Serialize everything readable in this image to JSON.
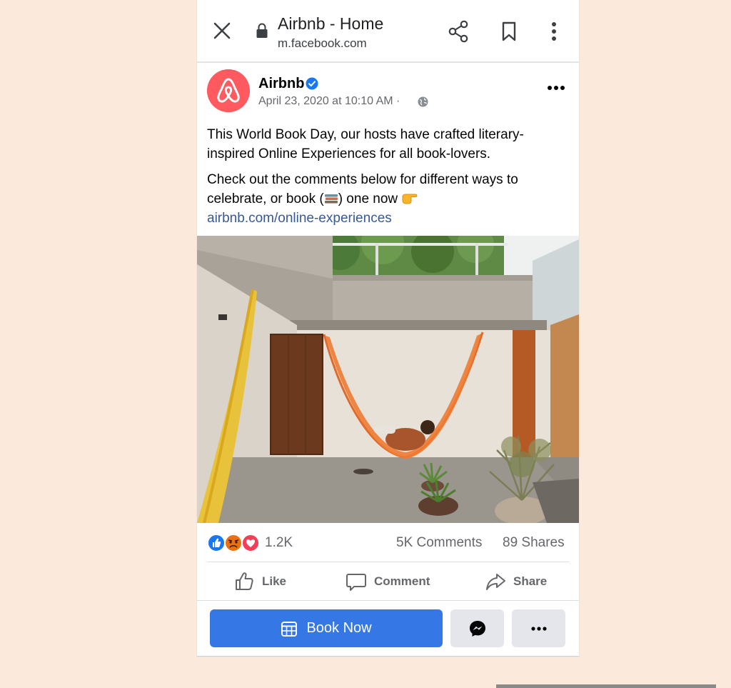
{
  "browser": {
    "title": "Airbnb - Home",
    "url": "m.facebook.com"
  },
  "post": {
    "page_name": "Airbnb",
    "timestamp": "April 23, 2020 at 10:10 AM · ",
    "text_para1": "This World Book Day, our hosts have crafted literary-inspired Online Experiences for all book-lovers.",
    "text_para2_a": "Check out the comments below for different ways to celebrate, or book (",
    "text_para2_b": ") one now ",
    "link": "airbnb.com/online-experiences",
    "reaction_count": "1.2K",
    "comments_count": "5K Comments",
    "shares_count": "89 Shares",
    "actions": {
      "like": "Like",
      "comment": "Comment",
      "share": "Share"
    },
    "cta": {
      "book_now": "Book Now"
    }
  },
  "colors": {
    "background": "#fbe9db",
    "brand_airbnb": "#ff5a5f",
    "facebook_blue": "#3578e5",
    "link": "#385898",
    "muted_text": "#65676b"
  },
  "icons": {
    "close": "close-icon",
    "lock": "lock-icon",
    "share": "share-icon",
    "bookmark": "bookmark-icon",
    "more": "more-vertical-icon",
    "verified": "verified-badge-icon",
    "globe": "globe-icon",
    "like": "thumbs-up-icon",
    "comment": "comment-icon",
    "forward": "share-arrow-icon",
    "calendar": "calendar-icon",
    "messenger": "messenger-icon",
    "ellipsis": "ellipsis-icon"
  }
}
